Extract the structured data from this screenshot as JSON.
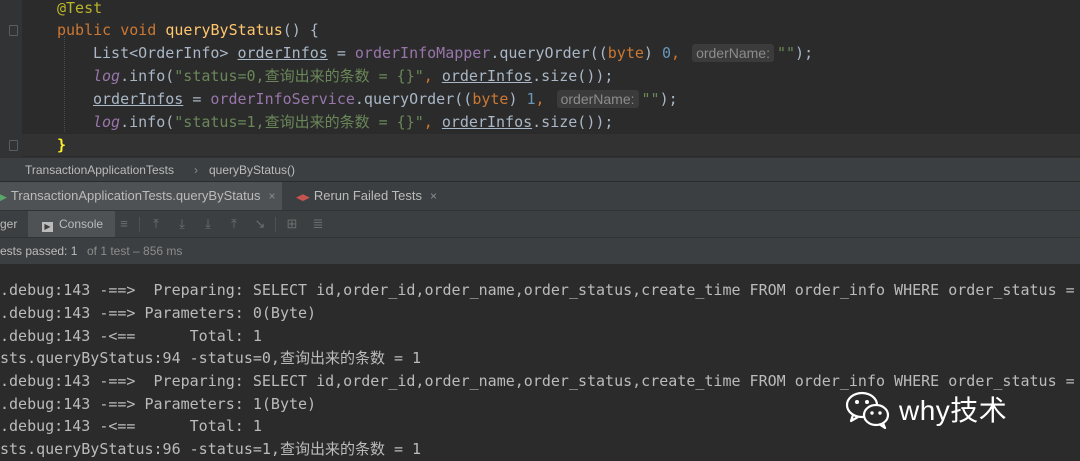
{
  "editor": {
    "lines": {
      "annotation": "@Test",
      "kw_public": "public",
      "kw_void": "void",
      "method_name": "queryByStatus",
      "method_sig": "() {",
      "l3_type": "List<OrderInfo> ",
      "l3_var": "orderInfos",
      "l3_eq": " = ",
      "l3_field": "orderInfoMapper",
      "l3_call": ".queryOrder((",
      "l3_kw": "byte",
      "l3_close": ") ",
      "l3_num": "0",
      "l3_comma": ", ",
      "l3_hint": "orderName:",
      "l3_str": "\"\"",
      "l3_end": ");",
      "l4_log": "log",
      "l4_info": ".info(",
      "l4_str": "\"status=0,查询出来的条数 = {}\"",
      "l4_comma": ", ",
      "l4_var": "orderInfos",
      "l4_end": ".size());",
      "l5_var": "orderInfos",
      "l5_eq": " = ",
      "l5_field": "orderInfoService",
      "l5_call": ".queryOrder((",
      "l5_kw": "byte",
      "l5_close": ") ",
      "l5_num": "1",
      "l5_comma": ", ",
      "l5_hint": "orderName:",
      "l5_str": "\"\"",
      "l5_end": ");",
      "l6_log": "log",
      "l6_info": ".info(",
      "l6_str": "\"status=1,查询出来的条数 = {}\"",
      "l6_comma": ", ",
      "l6_var": "orderInfos",
      "l6_end": ".size());",
      "closing_brace": "}"
    }
  },
  "breadcrumb": {
    "class_name": "TransactionApplicationTests",
    "separator": "›",
    "method": "queryByStatus()"
  },
  "run_tabs": [
    {
      "label": "TransactionApplicationTests.queryByStatus",
      "close": "×"
    },
    {
      "label": "Rerun Failed Tests",
      "close": "×"
    }
  ],
  "toolbar": {
    "debugger_label": "ger",
    "console_label": "Console",
    "icons": [
      "menu-lines-icon",
      "restore-icon",
      "step-over-icon",
      "step-into-icon",
      "step-up-icon",
      "run-to-cursor-icon",
      "frames-grid-icon",
      "evaluate-icon"
    ]
  },
  "status": {
    "main": "ests passed: 1",
    "sub": "of 1 test – 856 ms"
  },
  "console": {
    "lines": [
      ".debug:143 -==>  Preparing: SELECT id,order_id,order_name,order_status,create_time FROM order_info WHERE order_status = ?",
      ".debug:143 -==> Parameters: 0(Byte)",
      ".debug:143 -<==      Total: 1",
      "sts.queryByStatus:94 -status=0,查询出来的条数 = 1",
      ".debug:143 -==>  Preparing: SELECT id,order_id,order_name,order_status,create_time FROM order_info WHERE order_status = ?",
      ".debug:143 -==> Parameters: 1(Byte)",
      ".debug:143 -<==      Total: 1",
      "sts.queryByStatus:96 -status=1,查询出来的条数 = 1"
    ]
  },
  "watermark": {
    "text": "why技术",
    "icon": "wechat-icon"
  },
  "colors": {
    "editor_bg": "#2b2b2b",
    "panel_bg": "#3c3f41",
    "keyword": "#cc7832",
    "method": "#ffc66d",
    "field": "#9876aa",
    "string": "#6a8759",
    "number": "#6897bb",
    "pass_green": "#59a869",
    "fail_red": "#c75450"
  }
}
